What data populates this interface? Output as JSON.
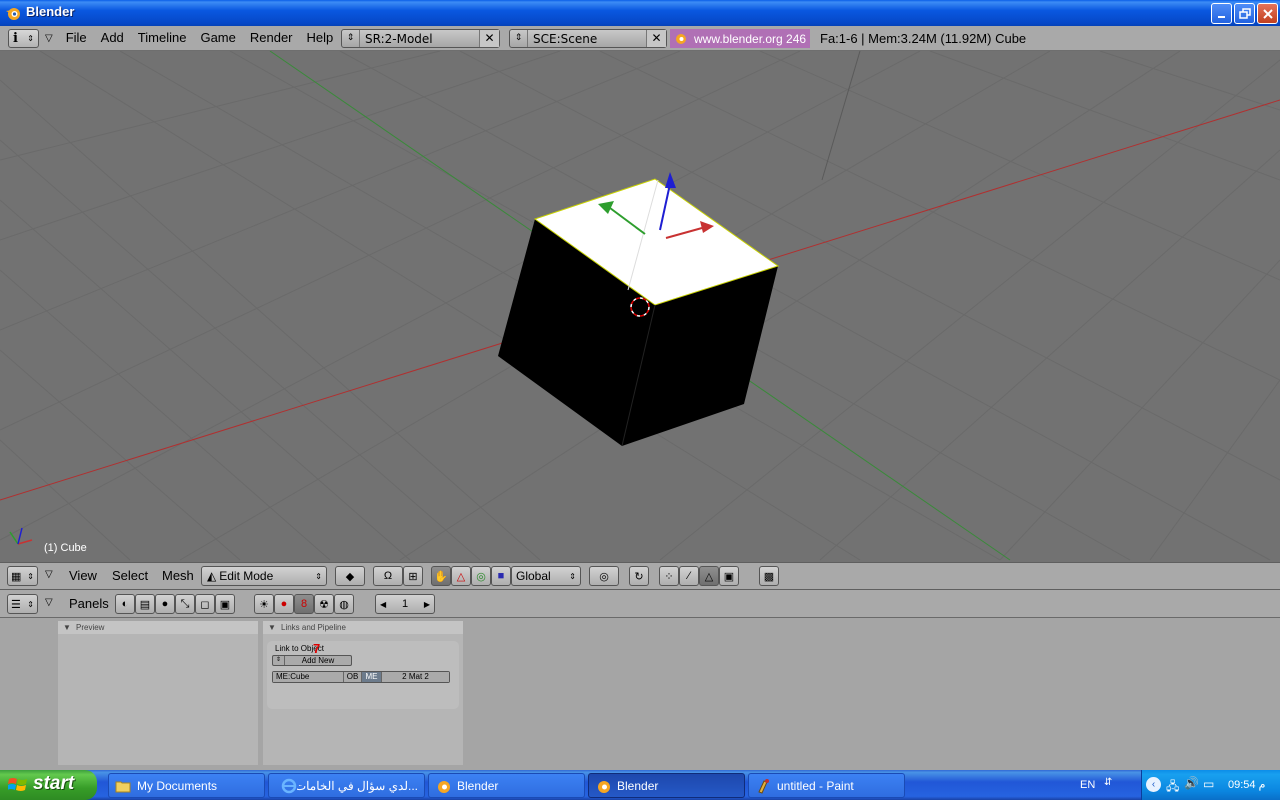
{
  "window": {
    "title": "Blender"
  },
  "top_header": {
    "menus": [
      "File",
      "Add",
      "Timeline",
      "Game",
      "Render",
      "Help"
    ],
    "screen_field": "SR:2-Model",
    "scene_field": "SCE:Scene",
    "version_label": "www.blender.org 246",
    "stats": "Fa:1-6 | Mem:3.24M (11.92M) Cube"
  },
  "viewport": {
    "object_label": "(1) Cube"
  },
  "view3d_header": {
    "menus": [
      "View",
      "Select",
      "Mesh"
    ],
    "mode": "Edit Mode",
    "orientation": "Global"
  },
  "buttons_header": {
    "label": "Panels",
    "frame": "1"
  },
  "panels": {
    "preview": {
      "title": "Preview"
    },
    "links": {
      "title": "Links and Pipeline",
      "link_label": "Link to Object",
      "add_new": "Add New",
      "mesh_name": "ME:Cube",
      "ob_btn": "OB",
      "me_btn": "ME",
      "mat_count": "2 Mat 2"
    }
  },
  "taskbar": {
    "start": "start",
    "tasks": [
      "My Documents",
      "...لدي سؤال في الخامات",
      "Blender",
      "Blender",
      "untitled - Paint"
    ],
    "lang": "EN",
    "clock": "09:54 م"
  },
  "colors": {
    "viewport_bg": "#727272",
    "x_axis": "#c83232",
    "y_axis": "#2e9e2e",
    "z_axis": "#1e1ed2",
    "xp_blue": "#0a58e0"
  }
}
